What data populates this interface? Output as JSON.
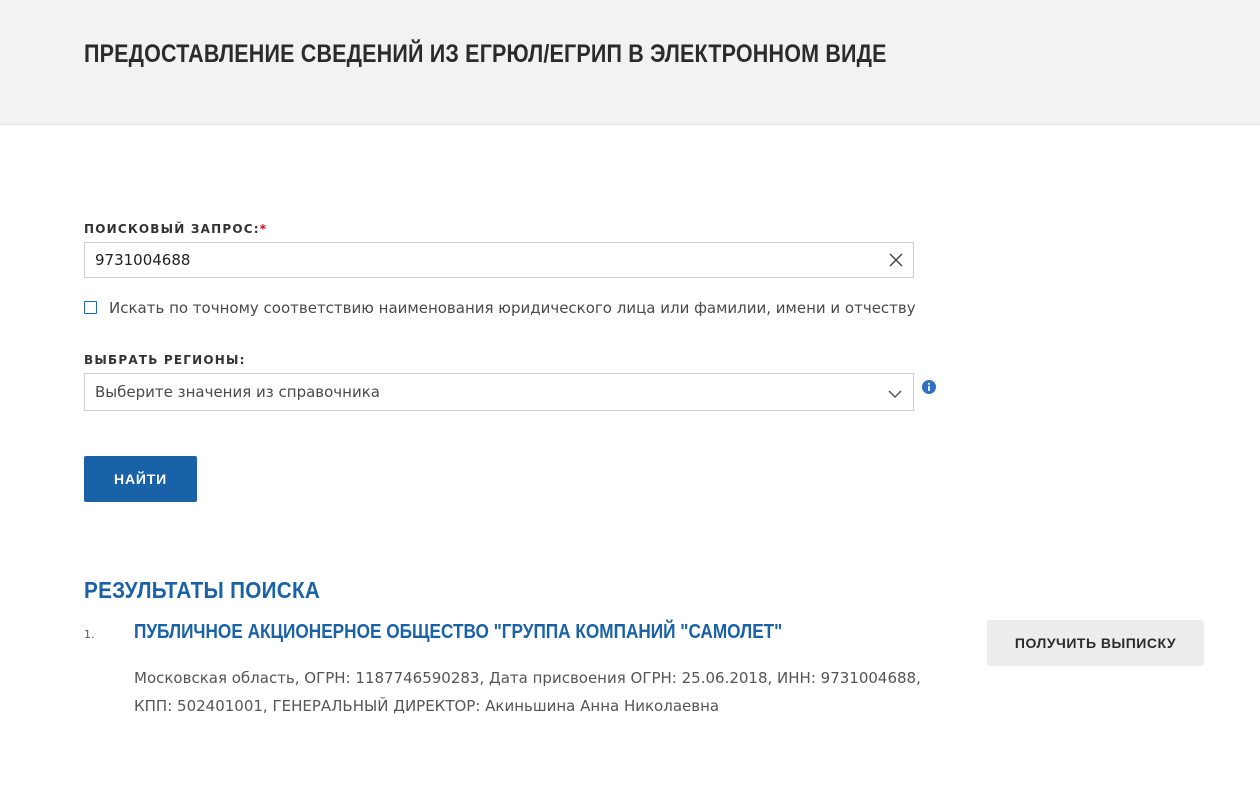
{
  "header": {
    "title": "ПРЕДОСТАВЛЕНИЕ СВЕДЕНИЙ ИЗ ЕГРЮЛ/ЕГРИП В ЭЛЕКТРОННОМ ВИДЕ"
  },
  "search": {
    "label": "ПОИСКОВЫЙ ЗАПРОС:",
    "required_mark": "*",
    "value": "9731004688",
    "clear_icon": "close-icon"
  },
  "exact_match": {
    "checked": false,
    "label": "Искать по точному соответствию наименования юридического лица или фамилии, имени и отчеству"
  },
  "regions": {
    "label": "ВЫБРАТЬ РЕГИОНЫ:",
    "placeholder": "Выберите значения из справочника",
    "dropdown_icon": "chevron-down-icon",
    "info_icon": "info-icon"
  },
  "find_button": {
    "label": "НАЙТИ"
  },
  "results": {
    "title": "РЕЗУЛЬТАТЫ ПОИСКА",
    "items": [
      {
        "number": "1.",
        "name": "ПУБЛИЧНОЕ АКЦИОНЕРНОЕ ОБЩЕСТВО \"ГРУППА КОМПАНИЙ \"САМОЛЕТ\"",
        "details": "Московская область, ОГРН: 1187746590283, Дата присвоения ОГРН: 25.06.2018, ИНН: 9731004688, КПП: 502401001, ГЕНЕРАЛЬНЫЙ ДИРЕКТОР: Акиньшина Анна Николаевна",
        "action_label": "ПОЛУЧИТЬ ВЫПИСКУ"
      }
    ]
  },
  "colors": {
    "accent": "#1a62a8",
    "header_bg": "#f2f2f2",
    "required": "#d0021b"
  }
}
